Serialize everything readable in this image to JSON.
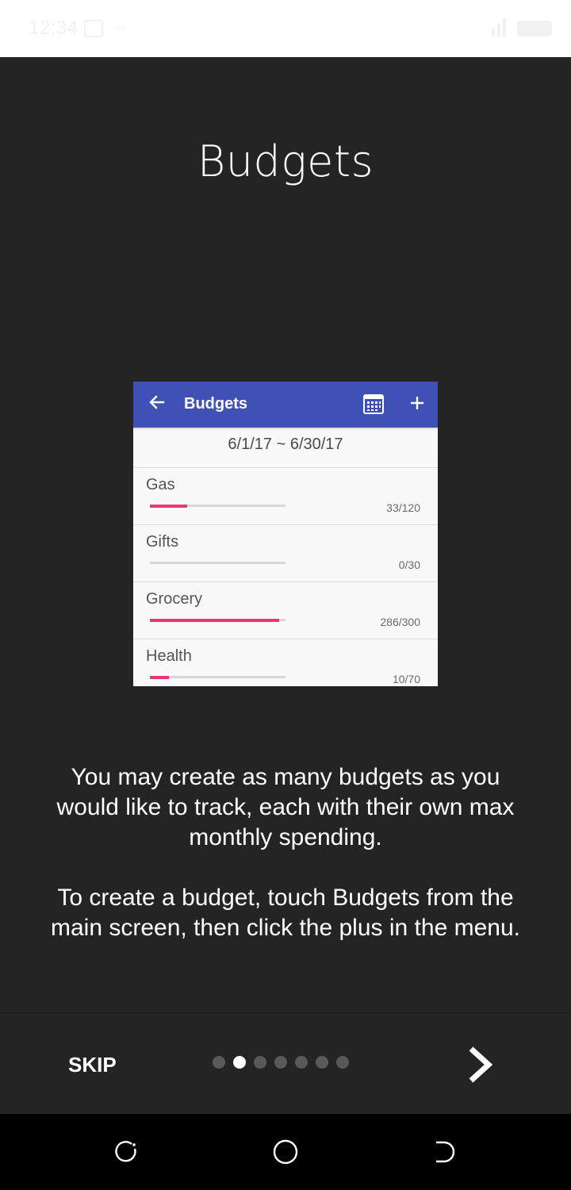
{
  "status_bar": {
    "time": "12:34",
    "dots": "··",
    "icons": [
      "image-icon",
      "signal-icon",
      "battery-icon"
    ]
  },
  "page": {
    "title": "Budgets"
  },
  "preview": {
    "toolbar": {
      "title": "Budgets",
      "color": "#3f51b5",
      "icons": [
        "back-arrow-icon",
        "calendar-icon",
        "plus-icon"
      ]
    },
    "date_range": "6/1/17 ~ 6/30/17",
    "progress_color": "#e8377a",
    "budgets": [
      {
        "name": "Gas",
        "amount": "33/120",
        "spent": 33,
        "max": 120
      },
      {
        "name": "Gifts",
        "amount": "0/30",
        "spent": 0,
        "max": 30
      },
      {
        "name": "Grocery",
        "amount": "286/300",
        "spent": 286,
        "max": 300
      },
      {
        "name": "Health",
        "amount": "10/70",
        "spent": 10,
        "max": 70
      }
    ]
  },
  "description": {
    "paragraph1": "You may create as many budgets as you would like to track, each with their own max monthly spending.",
    "paragraph2": "To create a budget, touch Budgets from the main screen, then click the plus in the menu."
  },
  "footer": {
    "skip_label": "SKIP",
    "page_count": 7,
    "current_page": 2,
    "next_icon": "chevron-right-icon"
  },
  "nav_bar": {
    "icons": [
      "recent-apps-icon",
      "home-icon",
      "back-icon"
    ]
  }
}
